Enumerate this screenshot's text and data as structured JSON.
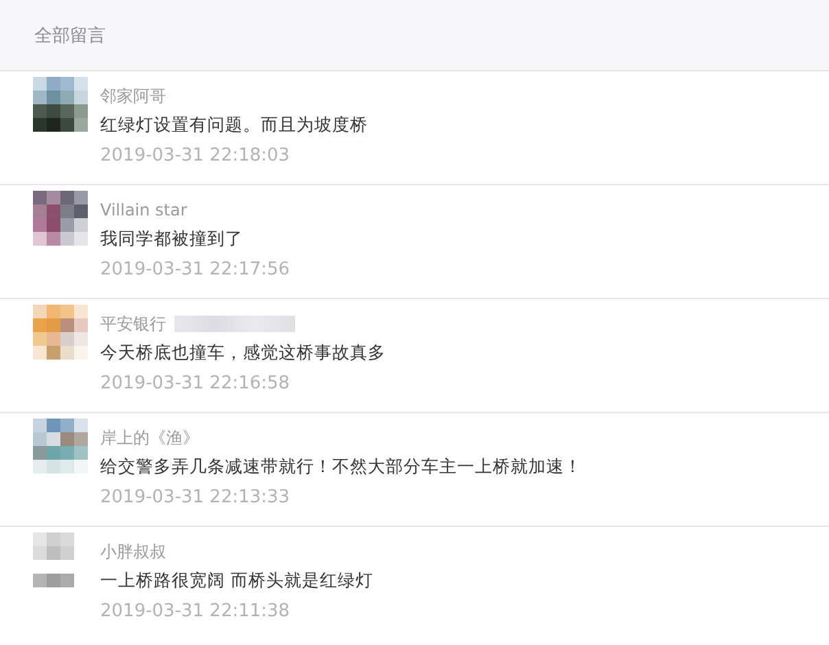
{
  "header": {
    "title": "全部留言"
  },
  "comments": [
    {
      "name": "邻家阿哥",
      "redacted": false,
      "text": "红绿灯设置有问题。而且为坡度桥",
      "time": "2019-03-31 22:18:03"
    },
    {
      "name": "Villain star",
      "redacted": false,
      "text": "我同学都被撞到了",
      "time": "2019-03-31 22:17:56"
    },
    {
      "name": "平安银行",
      "redacted": true,
      "text": "今天桥底也撞车，感觉这桥事故真多",
      "time": "2019-03-31 22:16:58"
    },
    {
      "name": "岸上的《渔》",
      "redacted": false,
      "text": "给交警多弄几条减速带就行！不然大部分车主一上桥就加速！",
      "time": "2019-03-31 22:13:33"
    },
    {
      "name": "小胖叔叔",
      "redacted": false,
      "text": "一上桥路很宽阔 而桥头就是红绿灯",
      "time": "2019-03-31 22:11:38"
    }
  ]
}
